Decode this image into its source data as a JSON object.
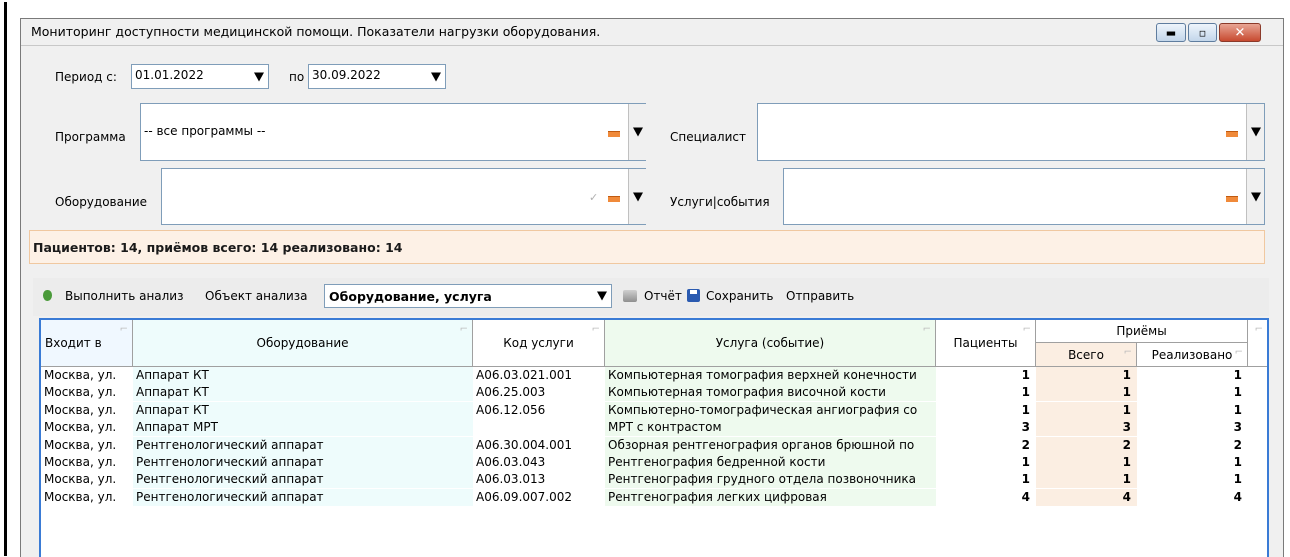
{
  "window": {
    "title": "Мониторинг доступности медицинской помощи. Показатели нагрузки оборудования."
  },
  "filters": {
    "period_from_label": "Период с:",
    "period_from_value": "01.01.2022",
    "period_to_label": "по",
    "period_to_value": "30.09.2022",
    "program_label": "Программа",
    "program_value": "-- все программы --",
    "specialist_label": "Специалист",
    "specialist_value": "",
    "equipment_label": "Оборудование",
    "equipment_value": "",
    "services_label": "Услуги|события",
    "services_value": ""
  },
  "summary": {
    "text": "Пациентов: 14, приёмов всего: 14 реализовано: 14"
  },
  "toolbar": {
    "run_label": "Выполнить анализ",
    "object_label": "Объект анализа",
    "object_value": "Оборудование, услуга",
    "report_label": "Отчёт",
    "save_label": "Сохранить",
    "send_label": "Отправить"
  },
  "table": {
    "columns": {
      "in": "Входит в",
      "equipment": "Оборудование",
      "code": "Код услуги",
      "service": "Услуга (событие)",
      "patients": "Пациенты",
      "visits_group": "Приёмы",
      "total": "Всего",
      "done": "Реализовано"
    },
    "rows": [
      {
        "in": "Москва, ул.",
        "equipment": "Аппарат КТ",
        "code": "A06.03.021.001",
        "service": "Компьютерная томография верхней конечности",
        "patients": "1",
        "total": "1",
        "done": "1"
      },
      {
        "in": "Москва, ул.",
        "equipment": "Аппарат КТ",
        "code": "A06.25.003",
        "service": "Компьютерная томография височной кости",
        "patients": "1",
        "total": "1",
        "done": "1"
      },
      {
        "in": "Москва, ул.",
        "equipment": "Аппарат КТ",
        "code": "A06.12.056",
        "service": "Компьютерно-томографическая ангиография со",
        "patients": "1",
        "total": "1",
        "done": "1"
      },
      {
        "in": "Москва, ул.",
        "equipment": "Аппарат МРТ",
        "code": "",
        "service": "МРТ с контрастом",
        "patients": "3",
        "total": "3",
        "done": "3"
      },
      {
        "in": "Москва, ул.",
        "equipment": "Рентгенологический аппарат",
        "code": "A06.30.004.001",
        "service": "Обзорная рентгенография органов брюшной по",
        "patients": "2",
        "total": "2",
        "done": "2"
      },
      {
        "in": "Москва, ул.",
        "equipment": "Рентгенологический аппарат",
        "code": "A06.03.043",
        "service": "Рентгенография бедренной кости",
        "patients": "1",
        "total": "1",
        "done": "1"
      },
      {
        "in": "Москва, ул.",
        "equipment": "Рентгенологический аппарат",
        "code": "A06.03.013",
        "service": "Рентгенография грудного отдела позвоночника",
        "patients": "1",
        "total": "1",
        "done": "1"
      },
      {
        "in": "Москва, ул.",
        "equipment": "Рентгенологический аппарат",
        "code": "A06.09.007.002",
        "service": "Рентгенография легких цифровая",
        "patients": "4",
        "total": "4",
        "done": "4"
      }
    ]
  }
}
